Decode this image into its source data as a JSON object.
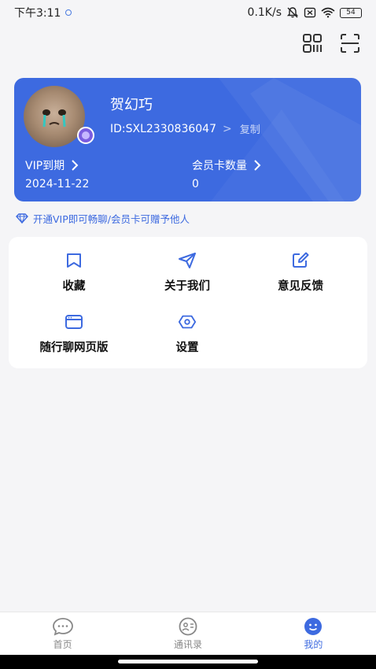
{
  "status_bar": {
    "time": "下午3:11",
    "network_speed": "0.1K/s",
    "battery": "54"
  },
  "top_actions": {
    "qr_icon": "qr-code-icon",
    "scan_icon": "scan-icon"
  },
  "profile": {
    "username": "贺幻巧",
    "user_id": "ID:SXL2330836047",
    "copy_label": "复制",
    "vip_label": "VIP到期",
    "vip_expiry": "2024-11-22",
    "cards_label": "会员卡数量",
    "cards_count": "0",
    "card_color": "#3d6ae0"
  },
  "vip_tip": "开通VIP即可畅聊/会员卡可赠予他人",
  "menu": {
    "items": [
      {
        "label": "收藏",
        "icon": "bookmark-icon"
      },
      {
        "label": "关于我们",
        "icon": "send-icon"
      },
      {
        "label": "意见反馈",
        "icon": "edit-icon"
      },
      {
        "label": "随行聊网页版",
        "icon": "browser-window-icon"
      },
      {
        "label": "设置",
        "icon": "settings-icon"
      }
    ]
  },
  "bottom_nav": {
    "items": [
      {
        "label": "首页",
        "icon": "chat-bubble-icon"
      },
      {
        "label": "通讯录",
        "icon": "contacts-icon"
      },
      {
        "label": "我的",
        "icon": "profile-icon"
      }
    ],
    "active": "我的",
    "accent": "#3d6ae0"
  }
}
